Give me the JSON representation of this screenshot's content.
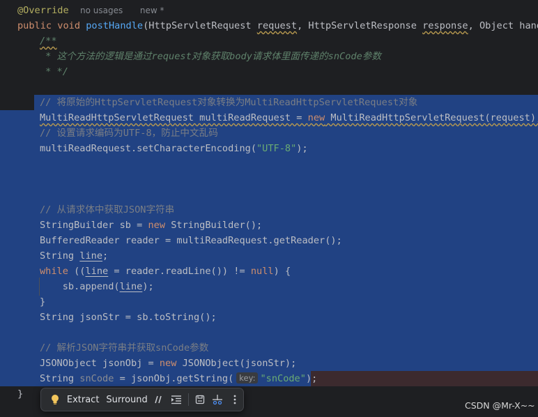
{
  "colors": {
    "background": "#1e1f22",
    "selection": "#214283",
    "keyword": "#cf8e6d",
    "string": "#6aab73",
    "comment": "#7a7e85",
    "method": "#56a8f5"
  },
  "code": {
    "l1": {
      "annotation": "@Override",
      "usages": "no usages",
      "new_label": "new *"
    },
    "l2": {
      "kw1": "public",
      "kw2": "void",
      "method": "postHandle",
      "p0": "(HttpServletRequest ",
      "request": "request",
      ",": ", HttpServletResponse ",
      "response": "response",
      "rest": ", Object handle"
    },
    "l3": {
      "text": "/**"
    },
    "l4": {
      "star": " * ",
      "zh1": "这个方法的逻辑是通过",
      "w1": "request",
      "zh2": "对象获取",
      "w2": "body",
      "zh3": "请求体里面传递的",
      "w3": "snCode",
      "zh4": "参数"
    },
    "l5": {
      "text": " * */"
    },
    "l7": {
      "text": "// 将原始的HttpServletRequest对象转换为MultiReadHttpServletRequest对象"
    },
    "l8": {
      "decl": "MultiReadHttpServletRequest multiReadRequest = ",
      "kw": "new",
      "rest": " MultiReadHttpServletRequest(request);"
    },
    "l9": {
      "text": "// 设置请求编码为UTF-8，防止中文乱码"
    },
    "l10": {
      "pre": "multiReadRequest.setCharacterEncoding(",
      "str": "\"UTF-8\"",
      "post": ");"
    },
    "l14": {
      "text": "// 从请求体中获取JSON字符串"
    },
    "l15": {
      "pre": "StringBuilder sb = ",
      "kw": "new",
      "post": " StringBuilder();"
    },
    "l16": {
      "text": "BufferedReader reader = multiReadRequest.getReader();"
    },
    "l17": {
      "pre": "String ",
      "var": "line",
      "post": ";"
    },
    "l18": {
      "kw": "while",
      "p1": " ((",
      "var": "line",
      "p2": " = reader.readLine()) != ",
      "kw2": "null",
      "p3": ") {"
    },
    "l19": {
      "pre": "    sb.append(",
      "var": "line",
      "post": ");"
    },
    "l20": {
      "text": "}"
    },
    "l21": {
      "text": "String jsonStr = sb.toString();"
    },
    "l23": {
      "text": "// 解析JSON字符串并获取snCode参数"
    },
    "l24": {
      "pre": "JSONObject jsonObj = ",
      "kw": "new",
      "post": " JSONObject(jsonStr);"
    },
    "l25": {
      "pre": "String ",
      "var": "snCode",
      "mid": " = jsonObj.getString(",
      "hint": "key:",
      "str": "\"snCode\"",
      "post": ");"
    },
    "l26": {
      "text": "}"
    }
  },
  "toolbar": {
    "bulb_icon": "lightbulb-icon",
    "extract_label": "Extract",
    "surround_label": "Surround",
    "comment_icon": "comment-icon",
    "reformat_icon": "reformat-icon",
    "save_icon": "save-icon",
    "scissors_icon": "split-icon",
    "more_icon": "more-icon"
  },
  "watermark": "CSDN @Mr-X~~"
}
